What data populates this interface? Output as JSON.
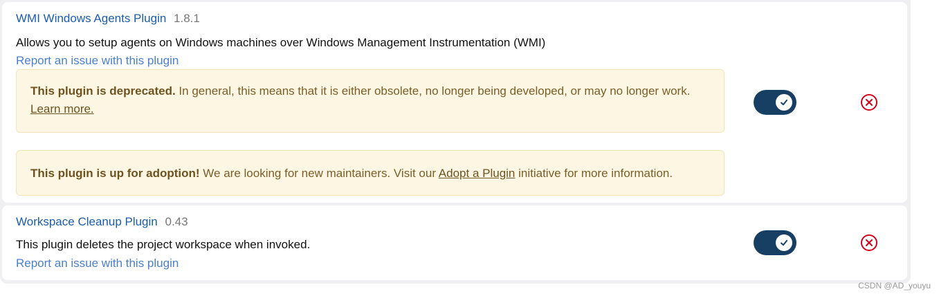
{
  "plugins": [
    {
      "name": "WMI Windows Agents Plugin",
      "version": "1.8.1",
      "description": "Allows you to setup agents on Windows machines over Windows Management Instrumentation (WMI)",
      "report_link": "Report an issue with this plugin",
      "deprecation_notice": {
        "title": "This plugin is deprecated.",
        "body": " In general, this means that it is either obsolete, no longer being developed, or may no longer work. ",
        "link": "Learn more."
      },
      "adoption_notice": {
        "title": "This plugin is up for adoption!",
        "body_before": " We are looking for new maintainers. Visit our ",
        "link": "Adopt a Plugin",
        "body_after": " initiative for more information."
      },
      "enabled": true
    },
    {
      "name": "Workspace Cleanup Plugin",
      "version": "0.43",
      "description": "This plugin deletes the project workspace when invoked.",
      "report_link": "Report an issue with this plugin",
      "enabled": true
    }
  ],
  "watermark": "CSDN @AD_youyu",
  "colors": {
    "link": "#1a5cb0",
    "toggle_on": "#173f63",
    "remove": "#d0021b",
    "notice_bg": "#fdf6e2"
  },
  "icons": {
    "toggle_knob": "check-icon",
    "remove": "circle-x-icon"
  }
}
